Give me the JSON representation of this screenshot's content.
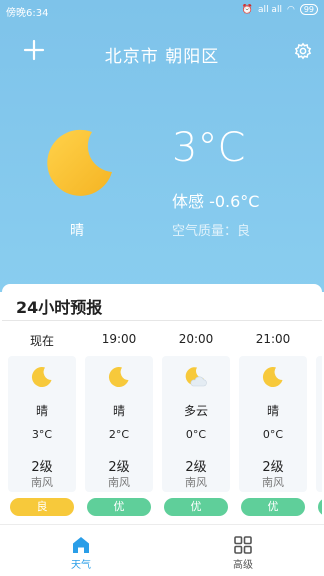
{
  "status_bar": {
    "time": "傍晚6:34",
    "signal_text": "all all",
    "battery": "99"
  },
  "header": {
    "add_icon": "plus-icon",
    "city": "北京市  朝阳区",
    "settings_icon": "gear-icon"
  },
  "current": {
    "icon": "moon-icon",
    "condition": "晴",
    "temperature": "3°C",
    "feels_like": "体感 -0.6°C",
    "air_quality": "空气质量：良"
  },
  "forecast": {
    "title": "24小时预报",
    "hours": [
      {
        "time": "现在",
        "icon": "moon-icon",
        "condition": "晴",
        "temp": "3°C",
        "wind_level": "2级",
        "wind_dir": "南风",
        "aqi": "良",
        "aqi_color": "#f7c93b"
      },
      {
        "time": "19:00",
        "icon": "moon-icon",
        "condition": "晴",
        "temp": "2°C",
        "wind_level": "2级",
        "wind_dir": "南风",
        "aqi": "优",
        "aqi_color": "#5fcf9a"
      },
      {
        "time": "20:00",
        "icon": "moon-cloud-icon",
        "condition": "多云",
        "temp": "0°C",
        "wind_level": "2级",
        "wind_dir": "南风",
        "aqi": "优",
        "aqi_color": "#5fcf9a"
      },
      {
        "time": "21:00",
        "icon": "moon-icon",
        "condition": "晴",
        "temp": "0°C",
        "wind_level": "2级",
        "wind_dir": "南风",
        "aqi": "优",
        "aqi_color": "#5fcf9a"
      }
    ]
  },
  "tabs": [
    {
      "label": "天气",
      "icon": "home-icon",
      "active": true,
      "color": "#2a9ee8"
    },
    {
      "label": "高级",
      "icon": "grid-icon",
      "active": false,
      "color": "#555555"
    }
  ],
  "colors": {
    "sky_top": "#7ec3ea",
    "accent": "#2a9ee8",
    "moon": "#f7c93b"
  }
}
